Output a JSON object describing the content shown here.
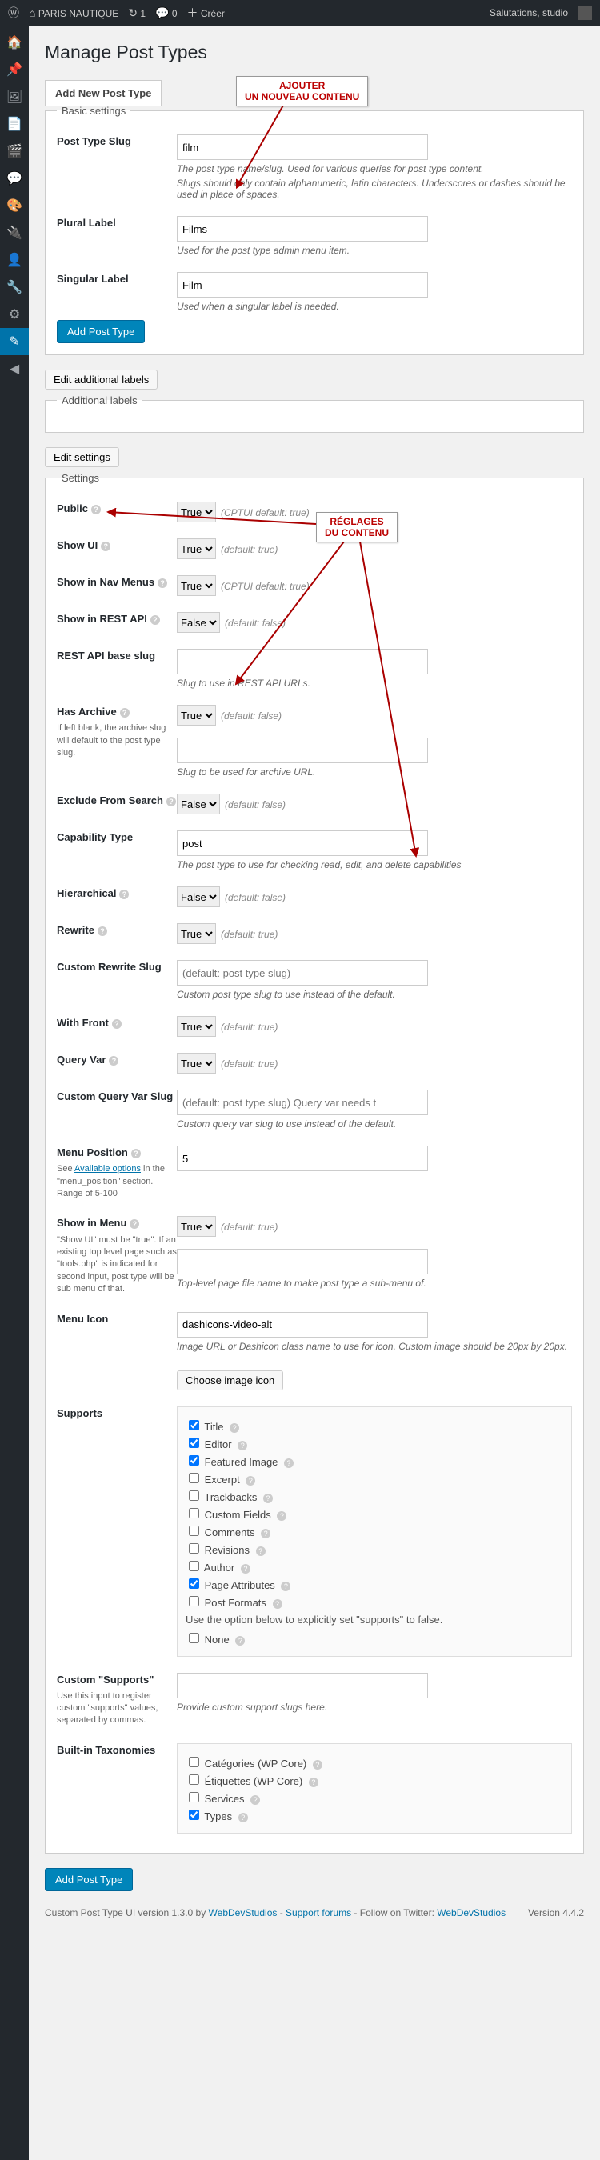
{
  "adminbar": {
    "site": "PARIS NAUTIQUE",
    "updates": "1",
    "comments": "0",
    "new": "Créer",
    "greet": "Salutations, studio"
  },
  "annotations": {
    "a1_l1": "AJOUTER",
    "a1_l2": "UN NOUVEAU CONTENU",
    "a2_l1": "RÉGLAGES",
    "a2_l2": "DU CONTENU"
  },
  "page_title": "Manage Post Types",
  "tab_add": "Add New Post Type",
  "basic": {
    "legend": "Basic settings",
    "slug_label": "Post Type Slug",
    "slug_value": "film",
    "slug_help1": "The post type name/slug. Used for various queries for post type content.",
    "slug_help2": "Slugs should only contain alphanumeric, latin characters. Underscores or dashes should be used in place of spaces.",
    "plural_label": "Plural Label",
    "plural_value": "Films",
    "plural_help": "Used for the post type admin menu item.",
    "singular_label": "Singular Label",
    "singular_value": "Film",
    "singular_help": "Used when a singular label is needed.",
    "submit": "Add Post Type"
  },
  "edit_additional": "Edit additional labels",
  "additional_labels_legend": "Additional labels",
  "edit_settings": "Edit settings",
  "settings": {
    "legend": "Settings",
    "public_label": "Public",
    "public_value": "True",
    "public_def": "(CPTUI default: true)",
    "showui_label": "Show UI",
    "showui_value": "True",
    "showui_def": "(default: true)",
    "showmenus_label": "Show in Nav Menus",
    "showmenus_value": "True",
    "showmenus_def": "(CPTUI default: true)",
    "rest_label": "Show in REST API",
    "rest_value": "False",
    "rest_def": "(default: false)",
    "restbase_label": "REST API base slug",
    "restbase_help": "Slug to use in REST API URLs.",
    "archive_label": "Has Archive",
    "archive_sub": "If left blank, the archive slug will default to the post type slug.",
    "archive_value": "True",
    "archive_def": "(default: false)",
    "archive_help": "Slug to be used for archive URL.",
    "exclude_label": "Exclude From Search",
    "exclude_value": "False",
    "exclude_def": "(default: false)",
    "cap_label": "Capability Type",
    "cap_value": "post",
    "cap_help": "The post type to use for checking read, edit, and delete capabilities",
    "hier_label": "Hierarchical",
    "hier_value": "False",
    "hier_def": "(default: false)",
    "rewrite_label": "Rewrite",
    "rewrite_value": "True",
    "rewrite_def": "(default: true)",
    "crs_label": "Custom Rewrite Slug",
    "crs_placeholder": "(default: post type slug)",
    "crs_help": "Custom post type slug to use instead of the default.",
    "wf_label": "With Front",
    "wf_value": "True",
    "wf_def": "(default: true)",
    "qv_label": "Query Var",
    "qv_value": "True",
    "qv_def": "(default: true)",
    "cqv_label": "Custom Query Var Slug",
    "cqv_placeholder": "(default: post type slug) Query var needs t",
    "cqv_help": "Custom query var slug to use instead of the default.",
    "mpos_label": "Menu Position",
    "mpos_sub": "See Available options in the \"menu_position\" section. Range of 5-100",
    "mpos_value": "5",
    "sim_label": "Show in Menu",
    "sim_sub": "\"Show UI\" must be \"true\". If an existing top level page such as \"tools.php\" is indicated for second input, post type will be sub menu of that.",
    "sim_value": "True",
    "sim_def": "(default: true)",
    "sim_help": "Top-level page file name to make post type a sub-menu of.",
    "micon_label": "Menu Icon",
    "micon_value": "dashicons-video-alt",
    "micon_help": "Image URL or Dashicon class name to use for icon. Custom image should be 20px by 20px.",
    "micon_btn": "Choose image icon",
    "supports_label": "Supports",
    "supports": {
      "title": "Title",
      "editor": "Editor",
      "featured": "Featured Image",
      "excerpt": "Excerpt",
      "trackbacks": "Trackbacks",
      "cfields": "Custom Fields",
      "comments": "Comments",
      "revisions": "Revisions",
      "author": "Author",
      "pageattr": "Page Attributes",
      "postfmt": "Post Formats",
      "note": "Use the option below to explicitly set \"supports\" to false.",
      "none": "None"
    },
    "csup_label": "Custom \"Supports\"",
    "csup_sub": "Use this input to register custom \"supports\" values, separated by commas.",
    "csup_help": "Provide custom support slugs here.",
    "tax_label": "Built-in Taxonomies",
    "tax": {
      "cat": "Catégories (WP Core)",
      "tag": "Étiquettes (WP Core)",
      "serv": "Services",
      "types": "Types"
    }
  },
  "bottom_submit": "Add Post Type",
  "footer": {
    "left1": "Custom Post Type UI version 1.3.0 by ",
    "wds": "WebDevStudios",
    "sep": " - ",
    "sf": "Support forums",
    "twit": " - Follow on Twitter: ",
    "twh": "WebDevStudios",
    "ver": "Version 4.4.2"
  }
}
